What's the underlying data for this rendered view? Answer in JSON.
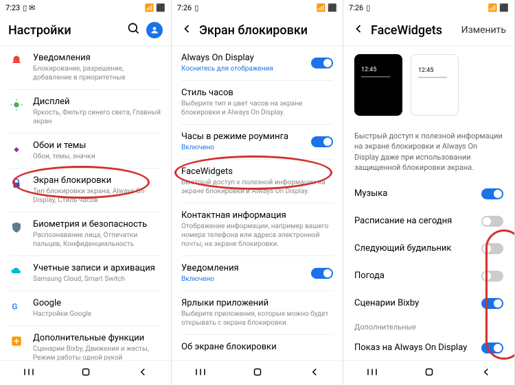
{
  "s1": {
    "time": "7:23",
    "title": "Настройки",
    "items": [
      {
        "title": "Уведомления",
        "sub": "Блокирование, разрешение, добавление в приоритетные"
      },
      {
        "title": "Дисплей",
        "sub": "Яркость, Фильтр синего света, Главный экран"
      },
      {
        "title": "Обои и темы",
        "sub": "Обои, темы, значки"
      },
      {
        "title": "Экран блокировки",
        "sub": "Тип блокировки экрана, Always On Display, Стиль часов"
      },
      {
        "title": "Биометрия и безопасность",
        "sub": "Распознавание лица, Отпечатки пальцев, Конфиденциальность"
      },
      {
        "title": "Учетные записи и архивация",
        "sub": "Samsung Cloud, Smart Switch"
      },
      {
        "title": "Google",
        "sub": "Настройки Google"
      },
      {
        "title": "Дополнительные функции",
        "sub": "Сценарии Bixby, Движения и жесты, Режим работы одной рукой"
      }
    ]
  },
  "s2": {
    "time": "7:26",
    "title": "Экран блокировки",
    "items": [
      {
        "title": "Always On Display",
        "sub": "Коснитесь для отображения",
        "link": true,
        "toggle": "on"
      },
      {
        "title": "Стиль часов",
        "sub": "Выберите тип и цвет часов на экране блокировки и Always On Display."
      },
      {
        "title": "Часы в режиме роуминга",
        "sub": "Включено",
        "link": true,
        "toggle": "on"
      },
      {
        "title": "FaceWidgets",
        "sub": "Быстрый доступ к полезной информации на экране блокировки и Always On Display."
      },
      {
        "title": "Контактная информация",
        "sub": "Отображение информации, например вашего номера телефона или адреса электронной почты, на экране блокировки."
      },
      {
        "title": "Уведомления",
        "sub": "Включено",
        "link": true,
        "toggle": "on"
      },
      {
        "title": "Ярлыки приложений",
        "sub": "Выберите приложения, которые можно будет открывать с экрана блокировки."
      },
      {
        "title": "Об экране блокировки",
        "sub": ""
      }
    ]
  },
  "s3": {
    "time": "7:26",
    "title": "FaceWidgets",
    "edit": "Изменить",
    "preview_time": "12:45",
    "desc": "Быстрый доступ к полезной информации на экране блокировки и Always On Display даже при использовании защищенной блокировки экрана.",
    "items": [
      {
        "title": "Музыка",
        "toggle": "on"
      },
      {
        "title": "Расписание на сегодня",
        "toggle": "off"
      },
      {
        "title": "Следующий будильник",
        "toggle": "off"
      },
      {
        "title": "Погода",
        "toggle": "off"
      },
      {
        "title": "Сценарии Bixby",
        "toggle": "on"
      }
    ],
    "section": "Дополнительные",
    "extra": {
      "title": "Показ на Always On Display",
      "toggle": "on"
    }
  }
}
